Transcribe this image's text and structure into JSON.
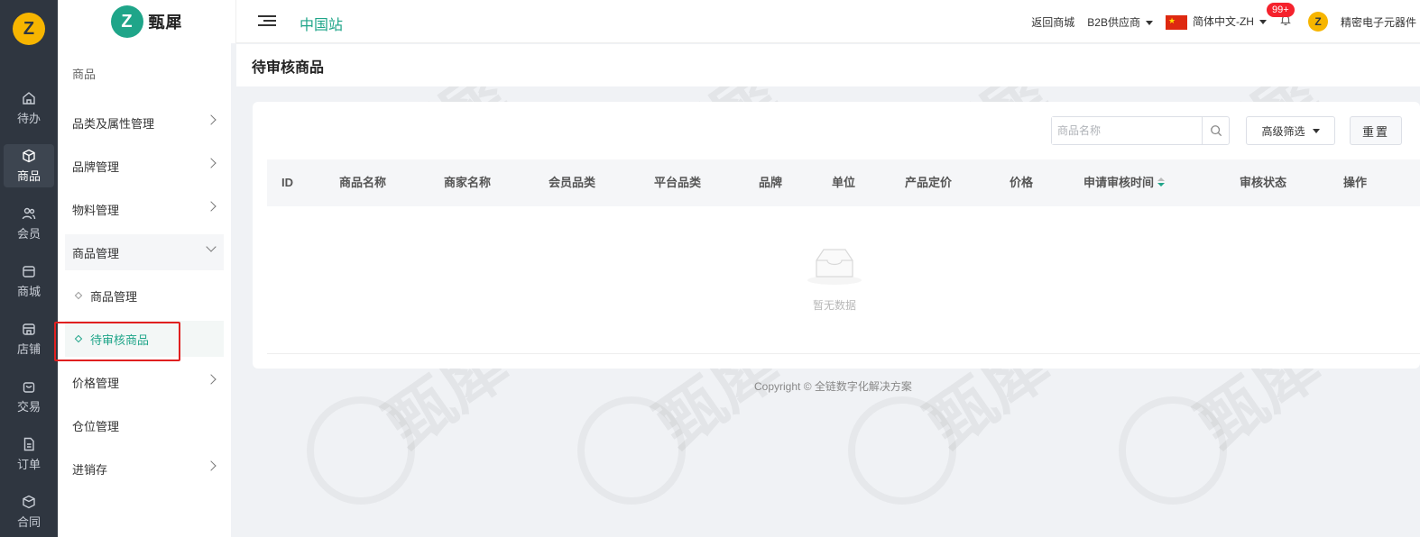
{
  "rail": {
    "logo": "Z",
    "items": [
      {
        "label": "待办",
        "icon": "home-icon"
      },
      {
        "label": "商品",
        "icon": "cube-icon",
        "active": true
      },
      {
        "label": "会员",
        "icon": "users-icon"
      },
      {
        "label": "商城",
        "icon": "store-icon"
      },
      {
        "label": "店铺",
        "icon": "shop-icon"
      },
      {
        "label": "交易",
        "icon": "bag-icon"
      },
      {
        "label": "订单",
        "icon": "document-icon"
      },
      {
        "label": "合同",
        "icon": "contract-icon"
      }
    ]
  },
  "brand": {
    "mark": "Z",
    "name": "甄犀"
  },
  "submenu": {
    "head": "商品",
    "items": [
      {
        "label": "品类及属性管理"
      },
      {
        "label": "品牌管理"
      },
      {
        "label": "物料管理"
      },
      {
        "label": "商品管理",
        "open": true
      },
      {
        "label": "商品管理"
      },
      {
        "label": "待审核商品",
        "active": true
      },
      {
        "label": "价格管理"
      },
      {
        "label": "仓位管理"
      },
      {
        "label": "进销存"
      }
    ]
  },
  "header": {
    "site": "中国站",
    "back_to_mall": "返回商城",
    "role": "B2B供应商",
    "language": "简体中文-ZH",
    "badge": "99+",
    "avatar": "Z",
    "user": "精密电子元器件"
  },
  "page": {
    "title": "待审核商品"
  },
  "toolbar": {
    "search_placeholder": "商品名称",
    "advanced_filter": "高级筛选",
    "reset": "重置"
  },
  "table": {
    "columns": [
      "ID",
      "商品名称",
      "商家名称",
      "会员品类",
      "平台品类",
      "品牌",
      "单位",
      "产品定价",
      "价格",
      "申请审核时间",
      "审核状态",
      "操作"
    ],
    "rows": [],
    "empty_text": "暂无数据"
  },
  "footer": {
    "text": "Copyright © 全链数字化解决方案"
  },
  "colors": {
    "accent": "#1fa589",
    "rail": "#2f3640",
    "logo": "#f7b500",
    "highlight": "#e02020"
  }
}
